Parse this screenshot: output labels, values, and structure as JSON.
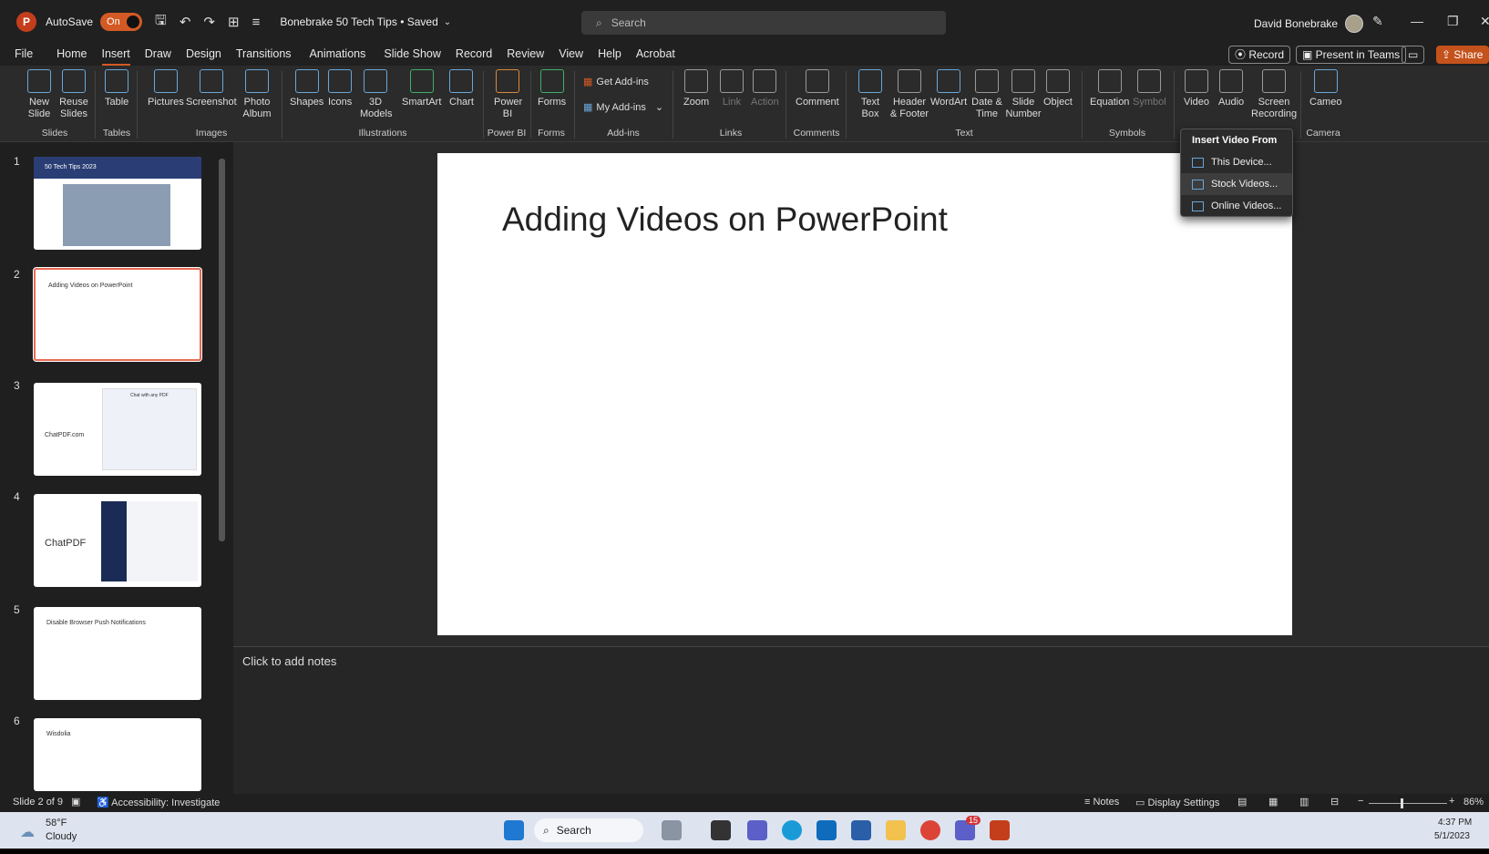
{
  "titlebar": {
    "autosave_label": "AutoSave",
    "autosave_state": "On",
    "doc_title": "Bonebrake 50 Tech Tips • Saved",
    "search_placeholder": "Search",
    "user_name": "David Bonebrake"
  },
  "menu": {
    "items": [
      "File",
      "Home",
      "Insert",
      "Draw",
      "Design",
      "Transitions",
      "Animations",
      "Slide Show",
      "Record",
      "Review",
      "View",
      "Help",
      "Acrobat"
    ],
    "active": "Insert",
    "record_btn": "Record",
    "present_btn": "Present in Teams",
    "share_btn": "Share"
  },
  "ribbon": {
    "new_slide": "New Slide",
    "reuse_slides": "Reuse Slides",
    "table": "Table",
    "pictures": "Pictures",
    "screenshot": "Screenshot",
    "photo_album": "Photo Album",
    "shapes": "Shapes",
    "icons": "Icons",
    "models": "3D Models",
    "smartart": "SmartArt",
    "chart": "Chart",
    "power_bi": "Power BI",
    "forms": "Forms",
    "get_addins": "Get Add-ins",
    "my_addins": "My Add-ins",
    "zoom": "Zoom",
    "link": "Link",
    "action": "Action",
    "comment": "Comment",
    "text_box": "Text Box",
    "header_footer": "Header & Footer",
    "wordart": "WordArt",
    "date_time": "Date & Time",
    "slide_number": "Slide Number",
    "object": "Object",
    "equation": "Equation",
    "symbol": "Symbol",
    "video": "Video",
    "audio": "Audio",
    "screen_recording": "Screen Recording",
    "cameo": "Cameo",
    "groups": {
      "slides": "Slides",
      "tables": "Tables",
      "images": "Images",
      "illustrations": "Illustrations",
      "power_bi": "Power BI",
      "forms": "Forms",
      "addins": "Add-ins",
      "links": "Links",
      "comments": "Comments",
      "text": "Text",
      "symbols": "Symbols",
      "camera": "Camera"
    }
  },
  "video_menu": {
    "header": "Insert Video From",
    "items": [
      "This Device...",
      "Stock Videos...",
      "Online Videos..."
    ]
  },
  "thumbnails": [
    {
      "num": "1",
      "text": "50 Tech Tips 2023"
    },
    {
      "num": "2",
      "text": "Adding Videos on PowerPoint"
    },
    {
      "num": "3",
      "text": "ChatPDF.com",
      "sub": "Chat with any PDF"
    },
    {
      "num": "4",
      "text": "ChatPDF"
    },
    {
      "num": "5",
      "text": "Disable Browser Push Notifications"
    },
    {
      "num": "6",
      "text": "Wisdolia"
    }
  ],
  "slide": {
    "title": "Adding Videos on PowerPoint"
  },
  "notes": {
    "placeholder": "Click to add notes"
  },
  "status": {
    "slide_info": "Slide 2 of 9",
    "accessibility": "Accessibility: Investigate",
    "notes": "Notes",
    "display": "Display Settings",
    "zoom": "86%"
  },
  "taskbar": {
    "weather_temp": "58°F",
    "weather_desc": "Cloudy",
    "search": "Search",
    "time": "4:37 PM",
    "date": "5/1/2023",
    "badge": "15"
  }
}
